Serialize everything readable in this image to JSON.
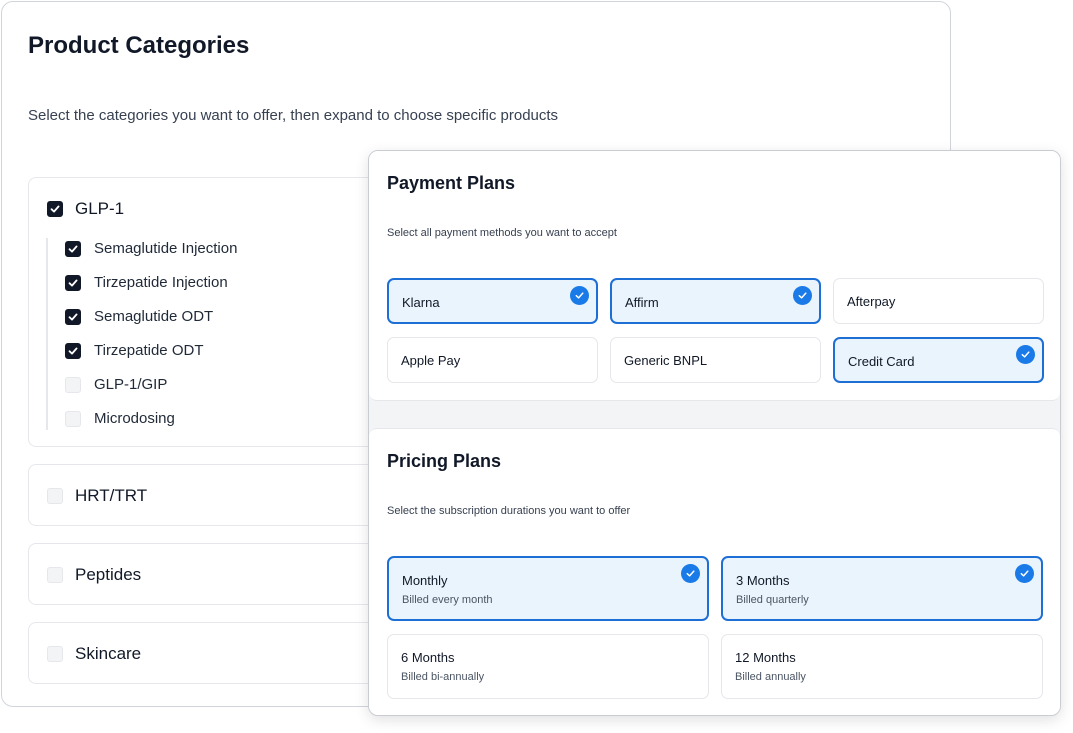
{
  "product_categories": {
    "title": "Product Categories",
    "subtitle": "Select the categories you want to offer, then expand to choose specific products",
    "categories": [
      {
        "label": "GLP-1",
        "checked": true,
        "items": [
          {
            "label": "Semaglutide Injection",
            "checked": true
          },
          {
            "label": "Tirzepatide Injection",
            "checked": true
          },
          {
            "label": "Semaglutide ODT",
            "checked": true
          },
          {
            "label": "Tirzepatide ODT",
            "checked": true
          },
          {
            "label": "GLP-1/GIP",
            "checked": false
          },
          {
            "label": "Microdosing",
            "checked": false
          }
        ]
      },
      {
        "label": "HRT/TRT",
        "checked": false
      },
      {
        "label": "Peptides",
        "checked": false
      },
      {
        "label": "Skincare",
        "checked": false
      }
    ]
  },
  "payment_plans": {
    "title": "Payment Plans",
    "subtitle": "Select all payment methods you want to accept",
    "options": [
      {
        "label": "Klarna",
        "selected": true
      },
      {
        "label": "Affirm",
        "selected": true
      },
      {
        "label": "Afterpay",
        "selected": false
      },
      {
        "label": "Apple Pay",
        "selected": false
      },
      {
        "label": "Generic BNPL",
        "selected": false
      },
      {
        "label": "Credit Card",
        "selected": true
      }
    ]
  },
  "pricing_plans": {
    "title": "Pricing Plans",
    "subtitle": "Select the subscription durations you want to offer",
    "options": [
      {
        "label": "Monthly",
        "description": "Billed every month",
        "selected": true
      },
      {
        "label": "3 Months",
        "description": "Billed quarterly",
        "selected": true
      },
      {
        "label": "6 Months",
        "description": "Billed bi-annually",
        "selected": false
      },
      {
        "label": "12 Months",
        "description": "Billed annually",
        "selected": false
      }
    ]
  },
  "colors": {
    "accent": "#1a7ae8",
    "selected_border": "#1d6fd6",
    "selected_bg": "#eaf4fd",
    "checkbox_on": "#111827"
  }
}
